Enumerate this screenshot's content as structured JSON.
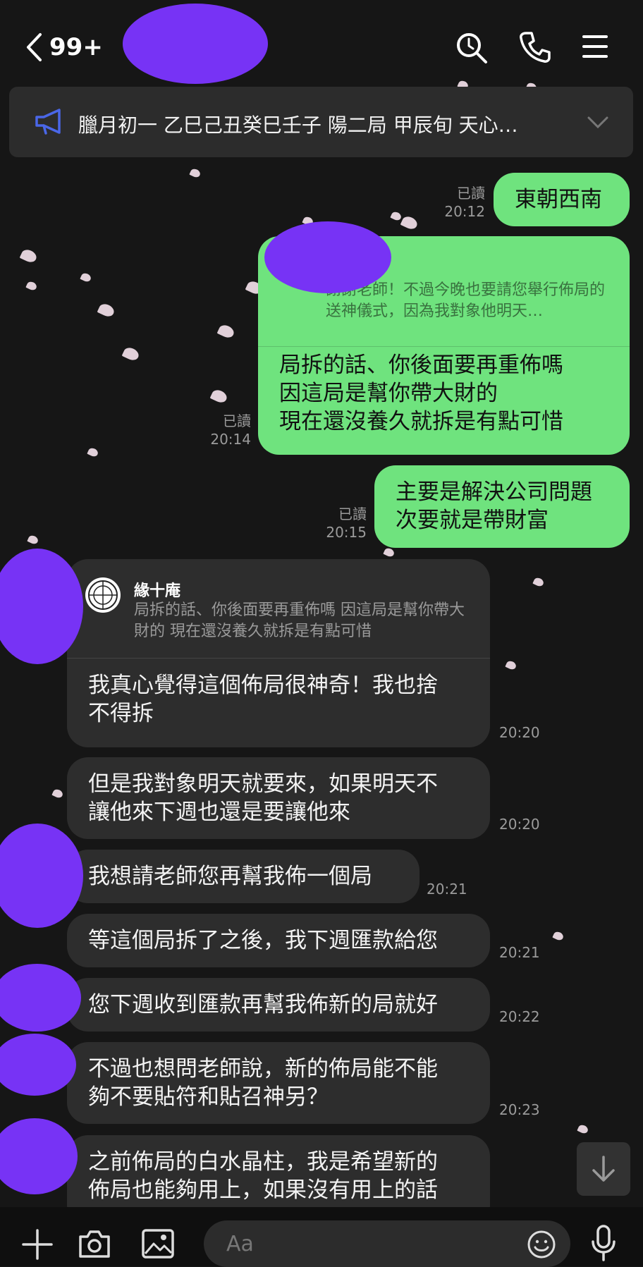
{
  "header": {
    "back_count": "99+"
  },
  "announcement": {
    "text": "臘月初一 乙巳己丑癸巳壬子 陽二局 甲辰旬 天心…"
  },
  "messages": {
    "m1": {
      "text": "東朝西南",
      "read": "已讀",
      "time": "20:12"
    },
    "m2": {
      "quote": "謝謝老師！不過今晚也要請您舉行佈局的送神儀式，因為我對象他明天…",
      "lines": [
        "局拆的話、你後面要再重佈嗎",
        "因這局是幫你帶大財的",
        "現在還沒養久就拆是有點可惜"
      ],
      "read": "已讀",
      "time": "20:14"
    },
    "m3": {
      "lines": [
        "主要是解決公司問題",
        "次要就是帶財富"
      ],
      "read": "已讀",
      "time": "20:15"
    },
    "t1": {
      "quote_name": "緣十庵",
      "quote": "局拆的話、你後面要再重佈嗎 因這局是幫你帶大財的 現在還沒養久就拆是有點可惜",
      "lines": [
        "我真心覺得這個佈局很神奇！我也捨",
        "不得拆"
      ],
      "time": "20:20"
    },
    "t2": {
      "lines": [
        "但是我對象明天就要來，如果明天不",
        "讓他來下週也還是要讓他來"
      ],
      "time": "20:20"
    },
    "t3": {
      "text": "我想請老師您再幫我佈一個局",
      "time": "20:21"
    },
    "t4": {
      "text": "等這個局拆了之後，我下週匯款給您",
      "time": "20:21"
    },
    "t5": {
      "text": "您下週收到匯款再幫我佈新的局就好",
      "time": "20:22"
    },
    "t6": {
      "lines": [
        "不過也想問老師說，新的佈局能不能",
        "夠不要貼符和貼召神另？"
      ],
      "time": "20:23"
    },
    "t7": {
      "lines": [
        "之前佈局的白水晶柱，我是希望新的",
        "佈局也能夠用上，如果沒有用上的話"
      ]
    }
  },
  "input": {
    "placeholder": "Aa"
  },
  "colors": {
    "my_bubble": "#6fe37e",
    "their_bubble": "#2d2d2d",
    "background": "#161616",
    "redaction": "#7733f5",
    "icon_accent": "#4a67e8"
  }
}
